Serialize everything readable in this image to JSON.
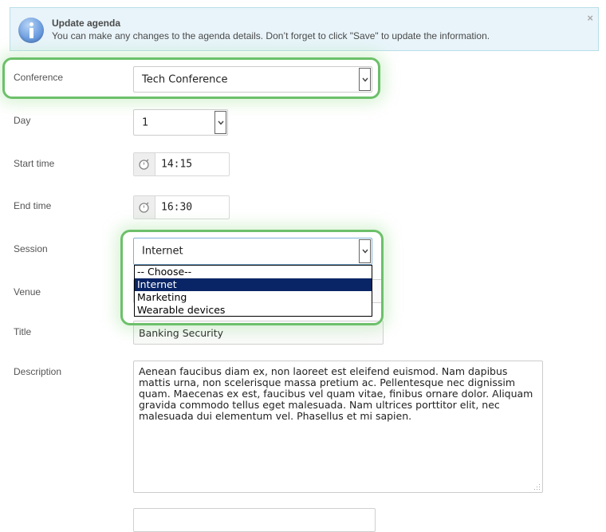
{
  "alert": {
    "icon": "info-icon",
    "title": "Update agenda",
    "message": "You can make any changes to the agenda details. Don’t forget to click \"Save\" to update the information.",
    "close_symbol": "×"
  },
  "form": {
    "conference": {
      "label": "Conference",
      "value": "Tech Conference"
    },
    "day": {
      "label": "Day",
      "value": "1"
    },
    "start_time": {
      "label": "Start time",
      "value": "14:15",
      "icon": "clock-icon"
    },
    "end_time": {
      "label": "End time",
      "value": "16:30",
      "icon": "clock-icon"
    },
    "session": {
      "label": "Session",
      "value": "Internet",
      "options": [
        "-- Choose--",
        "Internet",
        "Marketing",
        "Wearable devices"
      ],
      "selected_index": 1
    },
    "venue": {
      "label": "Venue",
      "value": ""
    },
    "title": {
      "label": "Title",
      "value": "Banking Security"
    },
    "description": {
      "label": "Description",
      "value": "Aenean faucibus diam ex, non laoreet est eleifend euismod. Nam dapibus mattis urna, non scelerisque massa pretium ac. Pellentesque nec dignissim quam. Maecenas ex est, faucibus vel quam vitae, finibus ornare dolor. Aliquam gravida commodo tellus eget malesuada. Nam ultrices porttitor elit, nec malesuada dui elementum vel. Phasellus et mi sapien."
    }
  },
  "colors": {
    "highlight": "#6cc06a",
    "selected_option": "#0a2566",
    "alert_bg": "#e8f4fa"
  }
}
